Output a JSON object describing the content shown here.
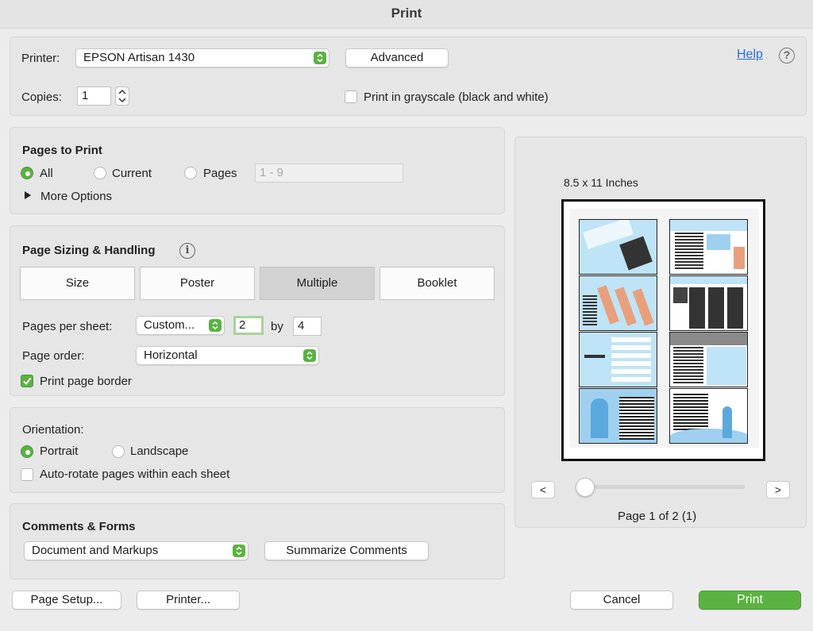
{
  "window": {
    "title": "Print"
  },
  "printer": {
    "label": "Printer:",
    "selected": "EPSON Artisan 1430",
    "advanced_label": "Advanced",
    "help_label": "Help",
    "help_icon": "?"
  },
  "copies": {
    "label": "Copies:",
    "value": "1",
    "grayscale_label": "Print in grayscale (black and white)",
    "grayscale_checked": false
  },
  "pages_to_print": {
    "heading": "Pages to Print",
    "options": [
      "All",
      "Current",
      "Pages"
    ],
    "selected": "All",
    "range_placeholder": "1 - 9",
    "more_options_label": "More Options"
  },
  "sizing": {
    "heading": "Page Sizing & Handling",
    "info_icon": "i",
    "tabs": [
      "Size",
      "Poster",
      "Multiple",
      "Booklet"
    ],
    "active_tab": "Multiple",
    "pages_per_sheet_label": "Pages per sheet:",
    "pages_per_sheet_value": "Custom...",
    "cols": "2",
    "by_label": "by",
    "rows": "4",
    "page_order_label": "Page order:",
    "page_order_value": "Horizontal",
    "border_label": "Print page border",
    "border_checked": true
  },
  "orientation": {
    "heading": "Orientation:",
    "options": [
      "Portrait",
      "Landscape"
    ],
    "selected": "Portrait",
    "autorotate_label": "Auto-rotate pages within each sheet",
    "autorotate_checked": false
  },
  "comments": {
    "heading": "Comments & Forms",
    "selected": "Document and Markups",
    "summarize_label": "Summarize Comments"
  },
  "preview": {
    "paper_size": "8.5 x 11 Inches",
    "prev_label": "<",
    "next_label": ">",
    "page_status": "Page 1 of 2 (1)"
  },
  "footer": {
    "page_setup_label": "Page Setup...",
    "printer_label": "Printer...",
    "cancel_label": "Cancel",
    "print_label": "Print"
  },
  "colors": {
    "accent": "#5ab241",
    "link": "#2a6fd6",
    "preview_blue": "#9fd0f0"
  }
}
